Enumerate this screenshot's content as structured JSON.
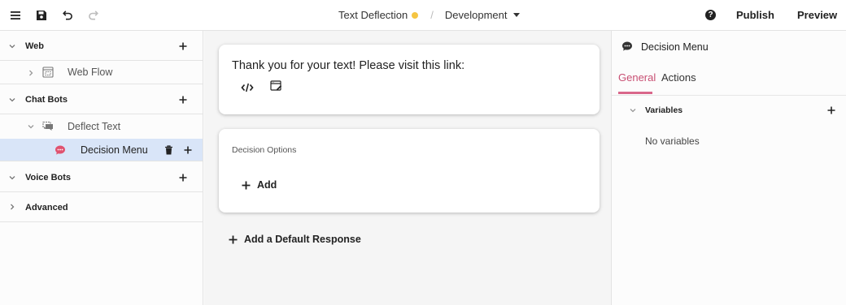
{
  "topbar": {
    "menu_icon": "hamburger-icon",
    "save_icon": "save-icon",
    "undo_icon": "undo-icon",
    "redo_icon": "redo-icon",
    "flow_name": "Text Deflection",
    "status_color": "#f5c542",
    "separator": "/",
    "environment": "Development",
    "help_icon": "?",
    "publish_label": "Publish",
    "preview_label": "Preview"
  },
  "sidebar": {
    "groups": [
      {
        "label": "Web",
        "expanded": true
      },
      {
        "label": "Chat Bots",
        "expanded": true
      },
      {
        "label": "Voice Bots",
        "expanded": true
      },
      {
        "label": "Advanced",
        "expanded": false
      }
    ],
    "items": [
      {
        "label": "Web Flow",
        "icon": "flow-icon"
      },
      {
        "label": "Deflect Text",
        "icon": "chat-bot-icon"
      },
      {
        "label": "Decision Menu",
        "icon": "decision-menu-icon",
        "selected": true
      }
    ]
  },
  "canvas": {
    "message_text": "Thank you for your text! Please visit this link:",
    "message_tools": [
      "code-icon",
      "web-link-icon"
    ],
    "decision_options_label": "Decision Options",
    "add_label": "Add",
    "add_default_label": "Add a Default Response"
  },
  "panel": {
    "title": "Decision Menu",
    "tabs": [
      "General",
      "Actions"
    ],
    "active_tab": "General",
    "variables_label": "Variables",
    "no_variables": "No variables"
  },
  "colors": {
    "accent": "#c84f73",
    "selected_row": "#d9e5f8",
    "decision_icon": "#e0526f"
  }
}
